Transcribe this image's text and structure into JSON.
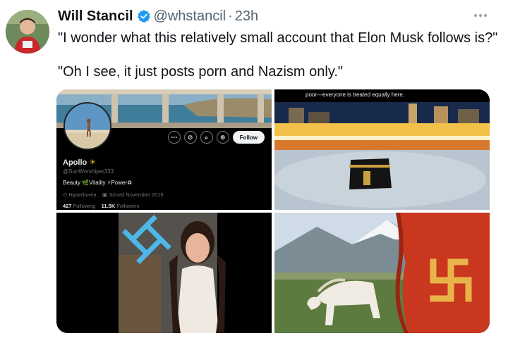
{
  "tweet": {
    "author": {
      "display_name": "Will Stancil",
      "handle": "@whstancil",
      "separator": "·",
      "time": "23h",
      "verified": true,
      "avatar_icon": "user-avatar"
    },
    "more_icon": "more-horizontal-icon",
    "text_lines": [
      "\"I wonder what this relatively small account that Elon Musk follows is?\"",
      "\"Oh I see, it just posts porn and Nazism only.\""
    ]
  },
  "media": {
    "profile_screenshot": {
      "name": "Apollo",
      "name_emoji": "sun-icon",
      "handle": "@SunWorshiper333",
      "bio": "Beauty 🌿Vitality ⚡Power♻",
      "location": "Hyperborea",
      "joined": "Joined November 2016",
      "following_count": "427",
      "following_label": "Following",
      "followers_count": "11.5K",
      "followers_label": "Followers",
      "follow_button": "Follow",
      "action_icons": [
        "more-icon",
        "grok-icon",
        "search-icon",
        "subscribe-icon"
      ]
    },
    "kaaba_image": {
      "caption": "poor—everyone is treated equally here."
    },
    "video_image": {},
    "horse_flag_image": {}
  },
  "colors": {
    "verified_blue": "#1d9bf0",
    "text_primary": "#0f1419",
    "text_secondary": "#536471"
  }
}
